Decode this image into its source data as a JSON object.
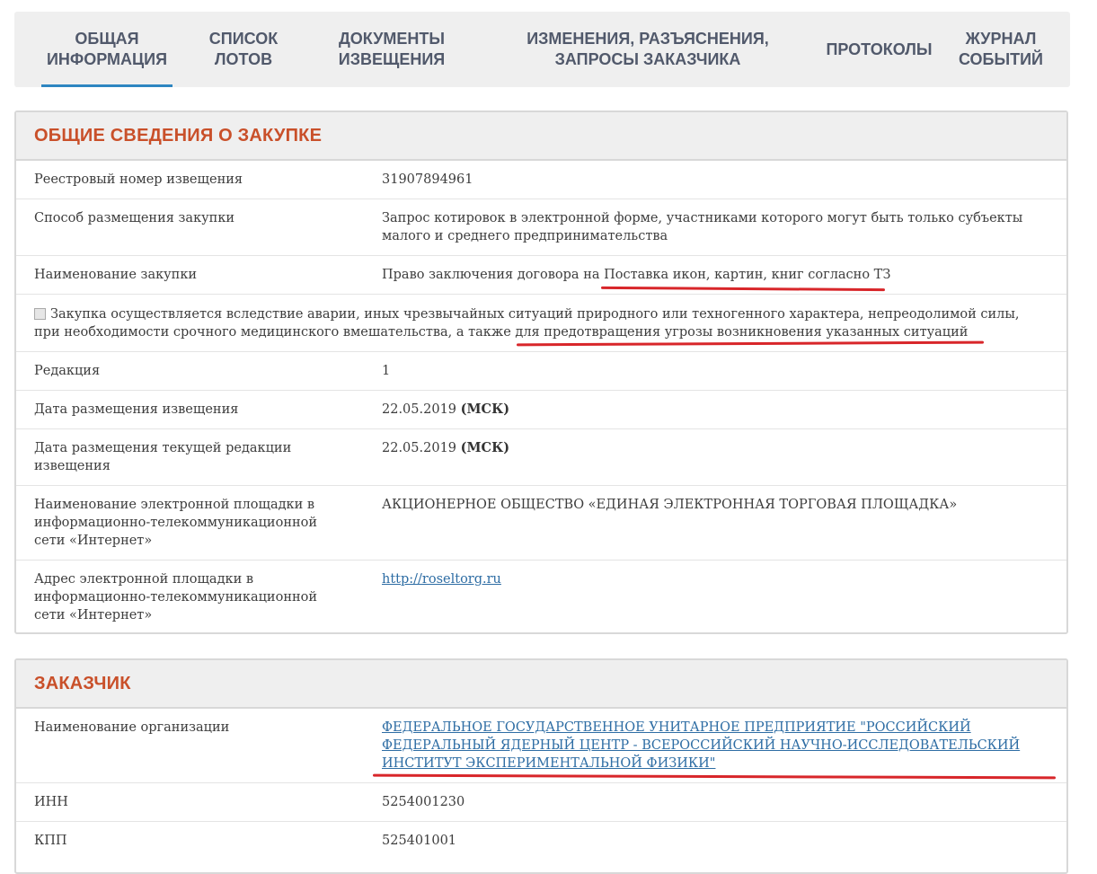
{
  "tabs": [
    {
      "label": "ОБЩАЯ\nИНФОРМАЦИЯ",
      "active": true
    },
    {
      "label": "СПИСОК\nЛОТОВ"
    },
    {
      "label": "ДОКУМЕНТЫ\nИЗВЕЩЕНИЯ"
    },
    {
      "label": "ИЗМЕНЕНИЯ, РАЗЪЯСНЕНИЯ,\nЗАПРОСЫ ЗАКАЗЧИКА"
    },
    {
      "label": "ПРОТОКОЛЫ"
    },
    {
      "label": "ЖУРНАЛ\nСОБЫТИЙ"
    }
  ],
  "general": {
    "title": "ОБЩИЕ СВЕДЕНИЯ О ЗАКУПКЕ",
    "registry_label": "Реестровый номер извещения",
    "registry_value": "31907894961",
    "method_label": "Способ размещения закупки",
    "method_value": "Запрос котировок в электронной форме, участниками которого могут быть только субъекты малого и среднего предпринимательства",
    "name_label": "Наименование закупки",
    "name_value": "Право заключения договора на Поставка икон, картин, книг согласно ТЗ",
    "emergency_text": "Закупка осуществляется вследствие аварии, иных чрезвычайных ситуаций природного или техногенного характера, непреодолимой силы, при необходимости срочного медицинского вмешательства, а также для предотвращения угрозы возникновения указанных ситуаций",
    "edition_label": "Редакция",
    "edition_value": "1",
    "posted_label": "Дата размещения извещения",
    "posted_date": "22.05.2019",
    "posted_tz": "(МСК)",
    "current_label": "Дата размещения текущей редакции извещения",
    "current_date": "22.05.2019",
    "current_tz": "(МСК)",
    "platform_name_label": "Наименование электронной площадки в информационно-телекоммуникационной сети «Интернет»",
    "platform_name_value": "АКЦИОНЕРНОЕ ОБЩЕСТВО «ЕДИНАЯ ЭЛЕКТРОННАЯ ТОРГОВАЯ ПЛОЩАДКА»",
    "platform_addr_label": "Адрес электронной площадки в информационно-телекоммуникационной сети «Интернет»",
    "platform_addr_value": "http://roseltorg.ru"
  },
  "customer": {
    "title": "ЗАКАЗЧИК",
    "org_label": "Наименование организации",
    "org_value": "ФЕДЕРАЛЬНОЕ ГОСУДАРСТВЕННОЕ УНИТАРНОЕ ПРЕДПРИЯТИЕ \"РОССИЙСКИЙ ФЕДЕРАЛЬНЫЙ ЯДЕРНЫЙ ЦЕНТР - ВСЕРОССИЙСКИЙ НАУЧНО-ИССЛЕДОВАТЕЛЬСКИЙ ИНСТИТУТ ЭКСПЕРИМЕНТАЛЬНОЙ ФИЗИКИ\"",
    "inn_label": "ИНН",
    "inn_value": "5254001230",
    "kpp_label": "КПП",
    "kpp_value": "525401001"
  },
  "colors": {
    "accent": "#c9502a",
    "link": "#2e6da4",
    "tab_underline": "#2e86c1",
    "annotation": "#d8262a"
  }
}
